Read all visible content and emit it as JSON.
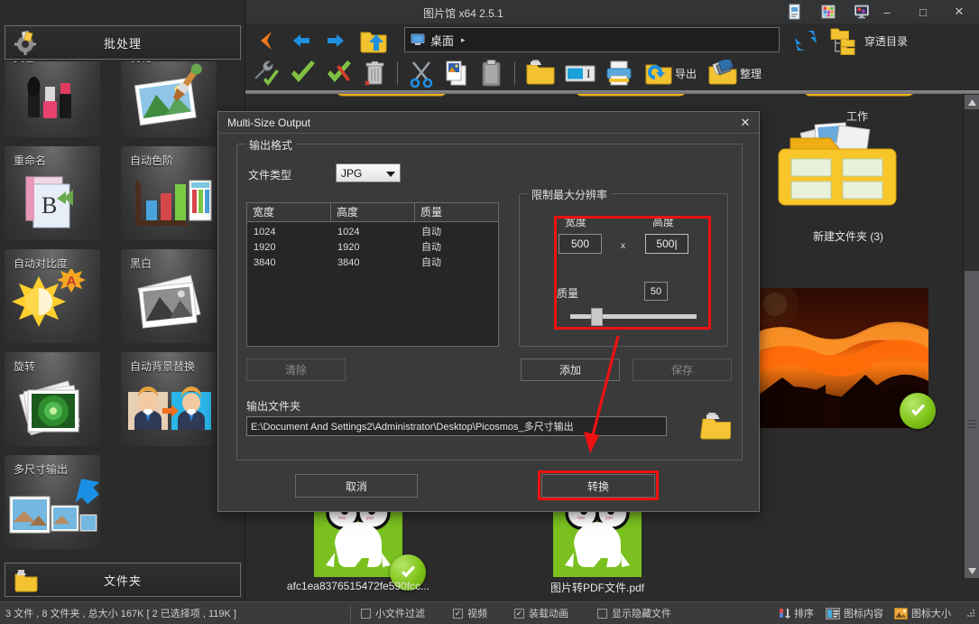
{
  "window": {
    "title": "图片馆 x64 2.5.1",
    "titlebar_icons": [
      "document-icon",
      "palette-icon",
      "monitor-icon"
    ],
    "minimize_label": "–",
    "maximize_label": "□",
    "close_label": "✕"
  },
  "sidebar": {
    "batch_button": {
      "label": "批处理",
      "icon": "batch-gear-icon"
    },
    "folder_button": {
      "label": "文件夹",
      "icon": "folder-icon"
    },
    "tiles": [
      {
        "label": "美容",
        "icon": "cosmetics-icon"
      },
      {
        "label": "优化",
        "icon": "photo-brush-icon"
      },
      {
        "label": "重命名",
        "icon": "rename-icon"
      },
      {
        "label": "自动色阶",
        "icon": "auto-levels-icon"
      },
      {
        "label": "自动对比度",
        "icon": "auto-contrast-icon"
      },
      {
        "label": "黑白",
        "icon": "black-white-icon"
      },
      {
        "label": "旋转",
        "icon": "rotate-icon"
      },
      {
        "label": "自动背景替换",
        "icon": "background-replace-icon"
      },
      {
        "label": "多尺寸输出",
        "icon": "multi-size-output-icon"
      }
    ]
  },
  "toolbar": {
    "nav": [
      {
        "name": "back-orange-icon",
        "label": ""
      },
      {
        "name": "back-blue-icon",
        "label": ""
      },
      {
        "name": "forward-blue-icon",
        "label": ""
      },
      {
        "name": "open-folder-up-icon",
        "label": ""
      }
    ],
    "address": {
      "icon": "desktop-icon",
      "value": "桌面",
      "arrow": "▸"
    },
    "refresh": {
      "name": "refresh-icon",
      "label": ""
    },
    "recurse": {
      "name": "folder-tree-icon",
      "label": "穿透目录"
    },
    "row2": [
      {
        "name": "settings-wrench-icon",
        "label": ""
      },
      {
        "name": "select-all-check-icon",
        "label": ""
      },
      {
        "name": "deselect-check-icon",
        "label": ""
      },
      {
        "name": "delete-trash-icon",
        "label": ""
      },
      {
        "name": "cut-scissors-icon",
        "label": ""
      },
      {
        "name": "copy-image-icon",
        "label": ""
      },
      {
        "name": "paste-clipboard-icon",
        "label": ""
      },
      {
        "name": "new-folder-icon",
        "label": ""
      },
      {
        "name": "rename-field-icon",
        "label": ""
      },
      {
        "name": "print-icon",
        "label": ""
      },
      {
        "name": "export-icon",
        "label": "导出"
      },
      {
        "name": "organize-icon",
        "label": "整理"
      }
    ]
  },
  "files": [
    {
      "label": "工作",
      "type": "folder-yellow"
    },
    {
      "label": "新建文件夹 (3)",
      "type": "folder-pictures"
    },
    {
      "label": "",
      "type": "image-sunset",
      "selected": true
    },
    {
      "label": "afc1ea8376515472fe590fcc...",
      "type": "image-green-rabbit",
      "selected": true
    },
    {
      "label": "图片转PDF文件.pdf",
      "type": "image-green-rabbit"
    }
  ],
  "dialog": {
    "title": "Multi-Size Output",
    "close_label": "✕",
    "output_format_group": "输出格式",
    "file_type_label": "文件类型",
    "file_type_value": "JPG",
    "size_table": {
      "headers": [
        "宽度",
        "高度",
        "质量"
      ],
      "rows": [
        [
          "1024",
          "1024",
          "自动"
        ],
        [
          "1920",
          "1920",
          "自动"
        ],
        [
          "3840",
          "3840",
          "自动"
        ]
      ]
    },
    "resolution_group": "限制最大分辨率",
    "width_label": "宽度",
    "height_label": "高度",
    "width_value": "500",
    "height_value": "500",
    "times_symbol": "x",
    "quality_label": "质量",
    "quality_value": "50",
    "quality_slider_percent": 17,
    "clear_button": "清除",
    "add_button": "添加",
    "save_button": "保存",
    "output_folder_label": "输出文件夹",
    "output_folder_value": "E:\\Document And Settings2\\Administrator\\Desktop\\Picosmos_多尺寸输出",
    "browse_icon": "folder-browse-icon",
    "cancel_button": "取消",
    "convert_button": "转换"
  },
  "statusbar": {
    "info": "3 文件 , 8 文件夹 , 总大小 167K [ 2 已选择项 , 119K ]",
    "checkboxes": [
      {
        "label": "小文件过滤",
        "checked": false
      },
      {
        "label": "视频",
        "checked": true
      },
      {
        "label": "装载动画",
        "checked": true
      },
      {
        "label": "显示隐藏文件",
        "checked": false
      }
    ],
    "right_items": [
      {
        "label": "排序",
        "icon": "sort-icon"
      },
      {
        "label": "图标内容",
        "icon": "icon-content-icon"
      },
      {
        "label": "图标大小",
        "icon": "icon-size-icon"
      }
    ]
  },
  "colors": {
    "accent_red": "#ee1111",
    "background": "#2b2b2b",
    "dialog_bg": "#3a3a3a",
    "check_green": "#7fc318"
  }
}
